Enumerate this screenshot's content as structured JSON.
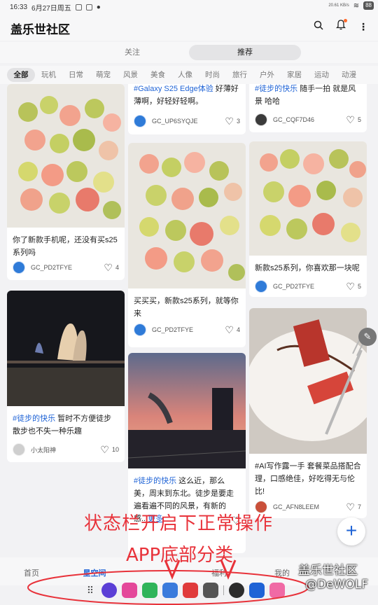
{
  "status": {
    "time": "16:33",
    "date": "6月27日周五",
    "net_speed": "20.61 KB/s",
    "battery": "88"
  },
  "header": {
    "title": "盖乐世社区"
  },
  "segments": {
    "follow": "关注",
    "recommend": "推荐"
  },
  "categories": [
    "全部",
    "玩机",
    "日常",
    "萌宠",
    "风景",
    "美食",
    "人像",
    "时尚",
    "旅行",
    "户外",
    "家居",
    "运动",
    "动漫"
  ],
  "cards": [
    {
      "text": "你了新款手机呢，还没有买s25系列吗",
      "tag": "",
      "user": "GC_PD2TFYE",
      "likes": "4"
    },
    {
      "text": " 暂时不方便徒步散步也不失一种乐趣",
      "tag": "#徒步的快乐",
      "user": "小太阳神",
      "likes": "10"
    },
    {
      "text": " 好薄好薄啊，好轻好轻啊。",
      "tag": "#Galaxy S25 Edge体验",
      "user": "GC_UP6SYQJE",
      "likes": "3"
    },
    {
      "text": "买买买，新款s25系列，就等你来",
      "tag": "",
      "user": "GC_PD2TFYE",
      "likes": "4"
    },
    {
      "text": " 这么近，那么美，周末到东北。徒步是要走遍看遍不同的风景，有新的感...",
      "tag": "#徒步的快乐",
      "more": "更多",
      "user": "",
      "likes": ""
    },
    {
      "text": " 随手一拍 就是风景 哈哈",
      "tag": "#徒步的快乐",
      "user": "GC_CQF7D46",
      "likes": "5"
    },
    {
      "text": "新款s25系列，你喜欢那一块呢",
      "tag": "",
      "user": "GC_PD2TFYE",
      "likes": "5"
    },
    {
      "text": "#AI写作露一手 套餐菜品搭配合理，口感绝佳，好吃得无与伦比!",
      "tag": "",
      "user": "GC_AFN8LEEM",
      "likes": "7"
    }
  ],
  "bottom_nav": [
    "首页",
    "星空间",
    "",
    "福利",
    "我的"
  ],
  "annotations": {
    "line1": "状态栏开启下正常操作",
    "line2": "APP底部分类",
    "watermark1": "盖乐世社区",
    "watermark2": "@DeWOLF"
  },
  "colors": {
    "accent": "#1f63d6",
    "overlay_red": "#e8323a"
  }
}
